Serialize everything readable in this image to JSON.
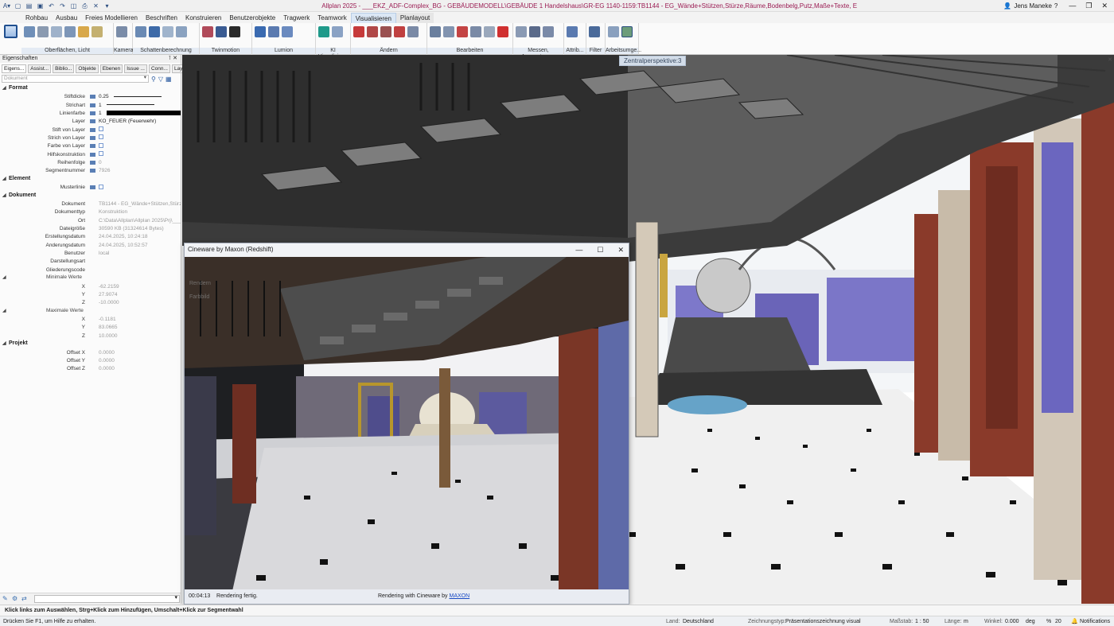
{
  "titlebar": {
    "app_title": "Allplan 2025 - ___EKZ_ADF-Complex_BG - GEBÄUDEMODELL\\GEBÄUDE 1 Handelshaus\\GR-EG 1140-1159:TB1144 - EG_Wände+Stützen,Stürze,Räume,Bodenbelg,Putz,Maße+Texte, E",
    "user": "Jens Maneke"
  },
  "ribbon_tabs": [
    "Rohbau",
    "Ausbau",
    "Freies Modellieren",
    "Beschriften",
    "Konstruieren",
    "Benutzerobjekte",
    "Tragwerk",
    "Teamwork",
    "Visualisieren",
    "Planlayout"
  ],
  "ribbon_groups": [
    "Oberflächen, Licht",
    "Kamera",
    "Schattenberechnung",
    "Twinmotion",
    "Lumion",
    "KI Visualisier...",
    "Ändern",
    "Bearbeiten",
    "Messen, Auswertung...",
    "Attrib...",
    "Filter",
    "Arbeitsumge..."
  ],
  "panel": {
    "title": "Eigenschaften",
    "tabs": [
      "Eigens...",
      "Assist...",
      "Biblio...",
      "Objekte",
      "Ebenen",
      "Issue ...",
      "Conn...",
      "Layer"
    ],
    "filter_placeholder": "Dokument",
    "sections": {
      "format": "Format",
      "element": "Element",
      "dokument": "Dokument",
      "projekt": "Projekt",
      "min": "Minimale Werte",
      "max": "Maximale Werte"
    },
    "format_rows": [
      {
        "label": "Stiftdicke",
        "value": "0.25"
      },
      {
        "label": "Strichart",
        "value": "1"
      },
      {
        "label": "Linienfarbe",
        "value": "1"
      },
      {
        "label": "Layer",
        "value": "KO_FEUER (Feuerwehr)"
      },
      {
        "label": "Stift von Layer",
        "value": ""
      },
      {
        "label": "Strich von Layer",
        "value": ""
      },
      {
        "label": "Farbe von Layer",
        "value": ""
      },
      {
        "label": "Hilfskonstruktion",
        "value": ""
      },
      {
        "label": "Reihenfolge",
        "value": "0"
      },
      {
        "label": "Segmentnummer",
        "value": "7926"
      }
    ],
    "element_rows": [
      {
        "label": "Musterlinie",
        "value": ""
      }
    ],
    "dokument_rows": [
      {
        "label": "Dokument",
        "value": "TB1144 - EG_Wände+Stützen,Stürze,R"
      },
      {
        "label": "Dokumenttyp",
        "value": "Konstruktion"
      },
      {
        "label": "Ort",
        "value": "C:\\Data\\Allplan\\Allplan 2025\\Prj\\___E"
      },
      {
        "label": "Dateigröße",
        "value": "30590 KB (31324614 Bytes)"
      },
      {
        "label": "Erstellungsdatum",
        "value": "24.04.2025, 10:24:18"
      },
      {
        "label": "Änderungsdatum",
        "value": "24.04.2025, 10:52:57"
      },
      {
        "label": "Benutzer",
        "value": "local"
      },
      {
        "label": "Darstellungsart",
        "value": ""
      },
      {
        "label": "Gliederungscode",
        "value": ""
      }
    ],
    "min_rows": [
      {
        "label": "X",
        "value": "-62.2159"
      },
      {
        "label": "Y",
        "value": "27.9074"
      },
      {
        "label": "Z",
        "value": "-10.0000"
      }
    ],
    "max_rows": [
      {
        "label": "X",
        "value": "-0.1181"
      },
      {
        "label": "Y",
        "value": "83.0665"
      },
      {
        "label": "Z",
        "value": "10.0000"
      }
    ],
    "projekt_rows": [
      {
        "label": "Offset X",
        "value": "0.0000"
      },
      {
        "label": "Offset Y",
        "value": "0.0000"
      },
      {
        "label": "Offset Z",
        "value": "0.0000"
      }
    ]
  },
  "viewport": {
    "label": "Zentralperspektive:3"
  },
  "render_window": {
    "title": "Cineware by Maxon (Redshift)",
    "time": "00:04:13",
    "status": "Rendering fertig.",
    "credit_prefix": "Rendering with Cineware by",
    "credit_link": "MAXON",
    "side_items": [
      "Rendern",
      "Farbbild"
    ]
  },
  "hint": "Klick links zum Auswählen, Strg+Klick zum Hinzufügen, Umschalt+Klick zur Segmentwahl",
  "statusbar": {
    "help": "Drücken Sie F1, um Hilfe zu erhalten.",
    "land_label": "Land:",
    "land": "Deutschland",
    "zt_label": "Zeichnungstyp:",
    "zt": "Präsentationszeichnung visual",
    "massstab_label": "Maßstab:",
    "massstab": "1 : 50",
    "laenge_label": "Länge:",
    "laenge": "m",
    "winkel_label": "Winkel:",
    "winkel": "0.000",
    "winkel_unit": "deg",
    "pct_sym": "%",
    "pct": "20",
    "notifications": "Notifications"
  },
  "colors": {
    "accent": "#1f4f8f",
    "title_text": "#9a1b52",
    "brick": "#8a3a2a"
  }
}
